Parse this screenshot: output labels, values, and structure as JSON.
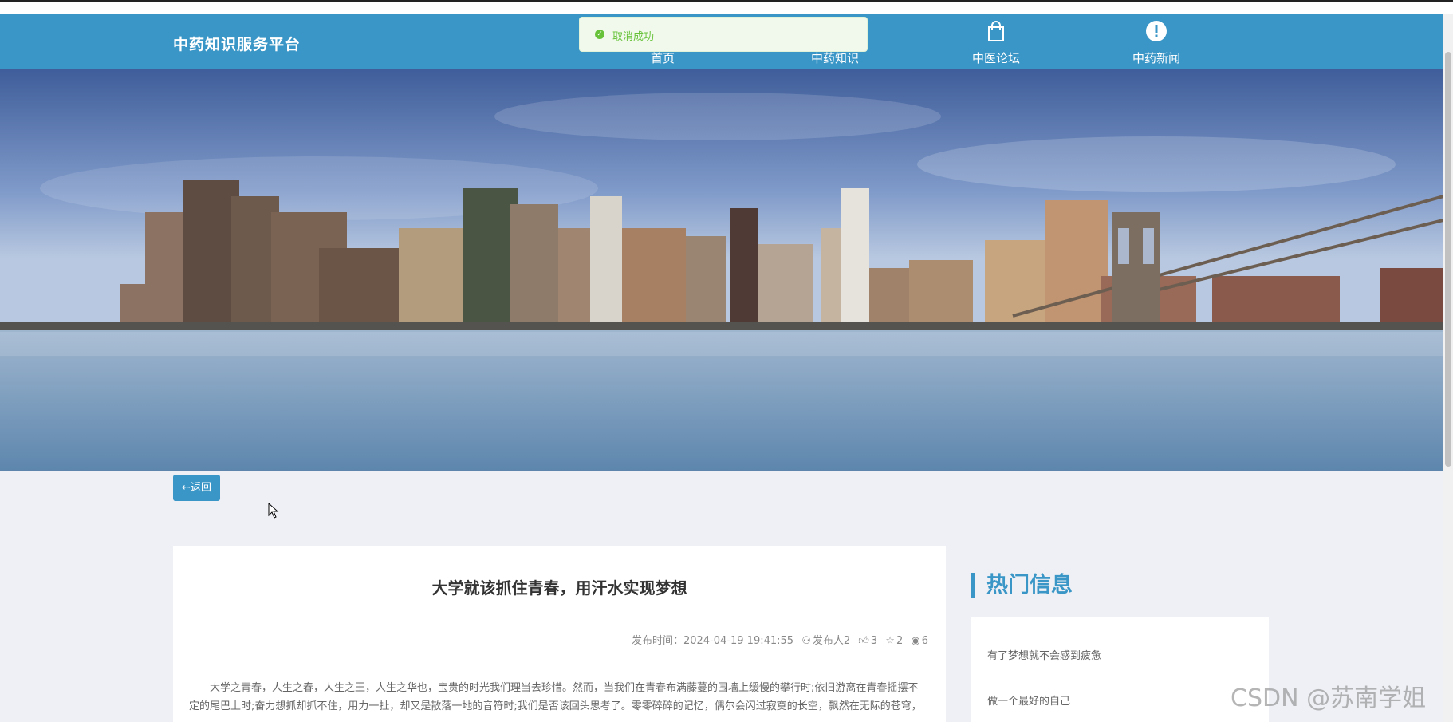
{
  "brand": "中药知识服务平台",
  "nav": {
    "items": [
      {
        "label": "首页",
        "icon": "home-icon"
      },
      {
        "label": "中药知识",
        "icon": "book-icon"
      },
      {
        "label": "中医论坛",
        "icon": "shopping-bag-icon"
      },
      {
        "label": "中药新闻",
        "icon": "alert-circle-icon"
      }
    ]
  },
  "toast": {
    "message": "取消成功",
    "icon": "success-check-icon"
  },
  "carousel": {
    "dots": 3,
    "active": 0
  },
  "back_button": "⇠返回",
  "article": {
    "title": "大学就该抓住青春，用汗水实现梦想",
    "published_label": "发布时间：",
    "published": "2024-04-19 19:41:55",
    "author": "发布人2",
    "likes": "3",
    "favorites": "2",
    "views": "6",
    "body": "大学之青春，人生之春，人生之王，人生之华也，宝贵的时光我们理当去珍惜。然而，当我们在青春布满藤蔓的围墙上缓慢的攀行时;依旧游离在青春摇摆不定的尾巴上时;奋力想抓却抓不住，用力一扯，却又是散落一地的音符时;我们是否该回头思考了。零零碎碎的记忆，偶尔会闪过寂寞的长空，飘然在无际的苍穹，仅仅留下几颗闪烁的残星让我们自己溶思，青春易逝，好似东逝的水，去不复还。"
  },
  "hot": {
    "title": "热门信息",
    "items": [
      "有了梦想就不会感到疲惫",
      "做一个最好的自己"
    ]
  },
  "watermark": "CSDN @苏南学姐",
  "colors": {
    "accent": "#3a96c6",
    "success": "#67c23a"
  }
}
